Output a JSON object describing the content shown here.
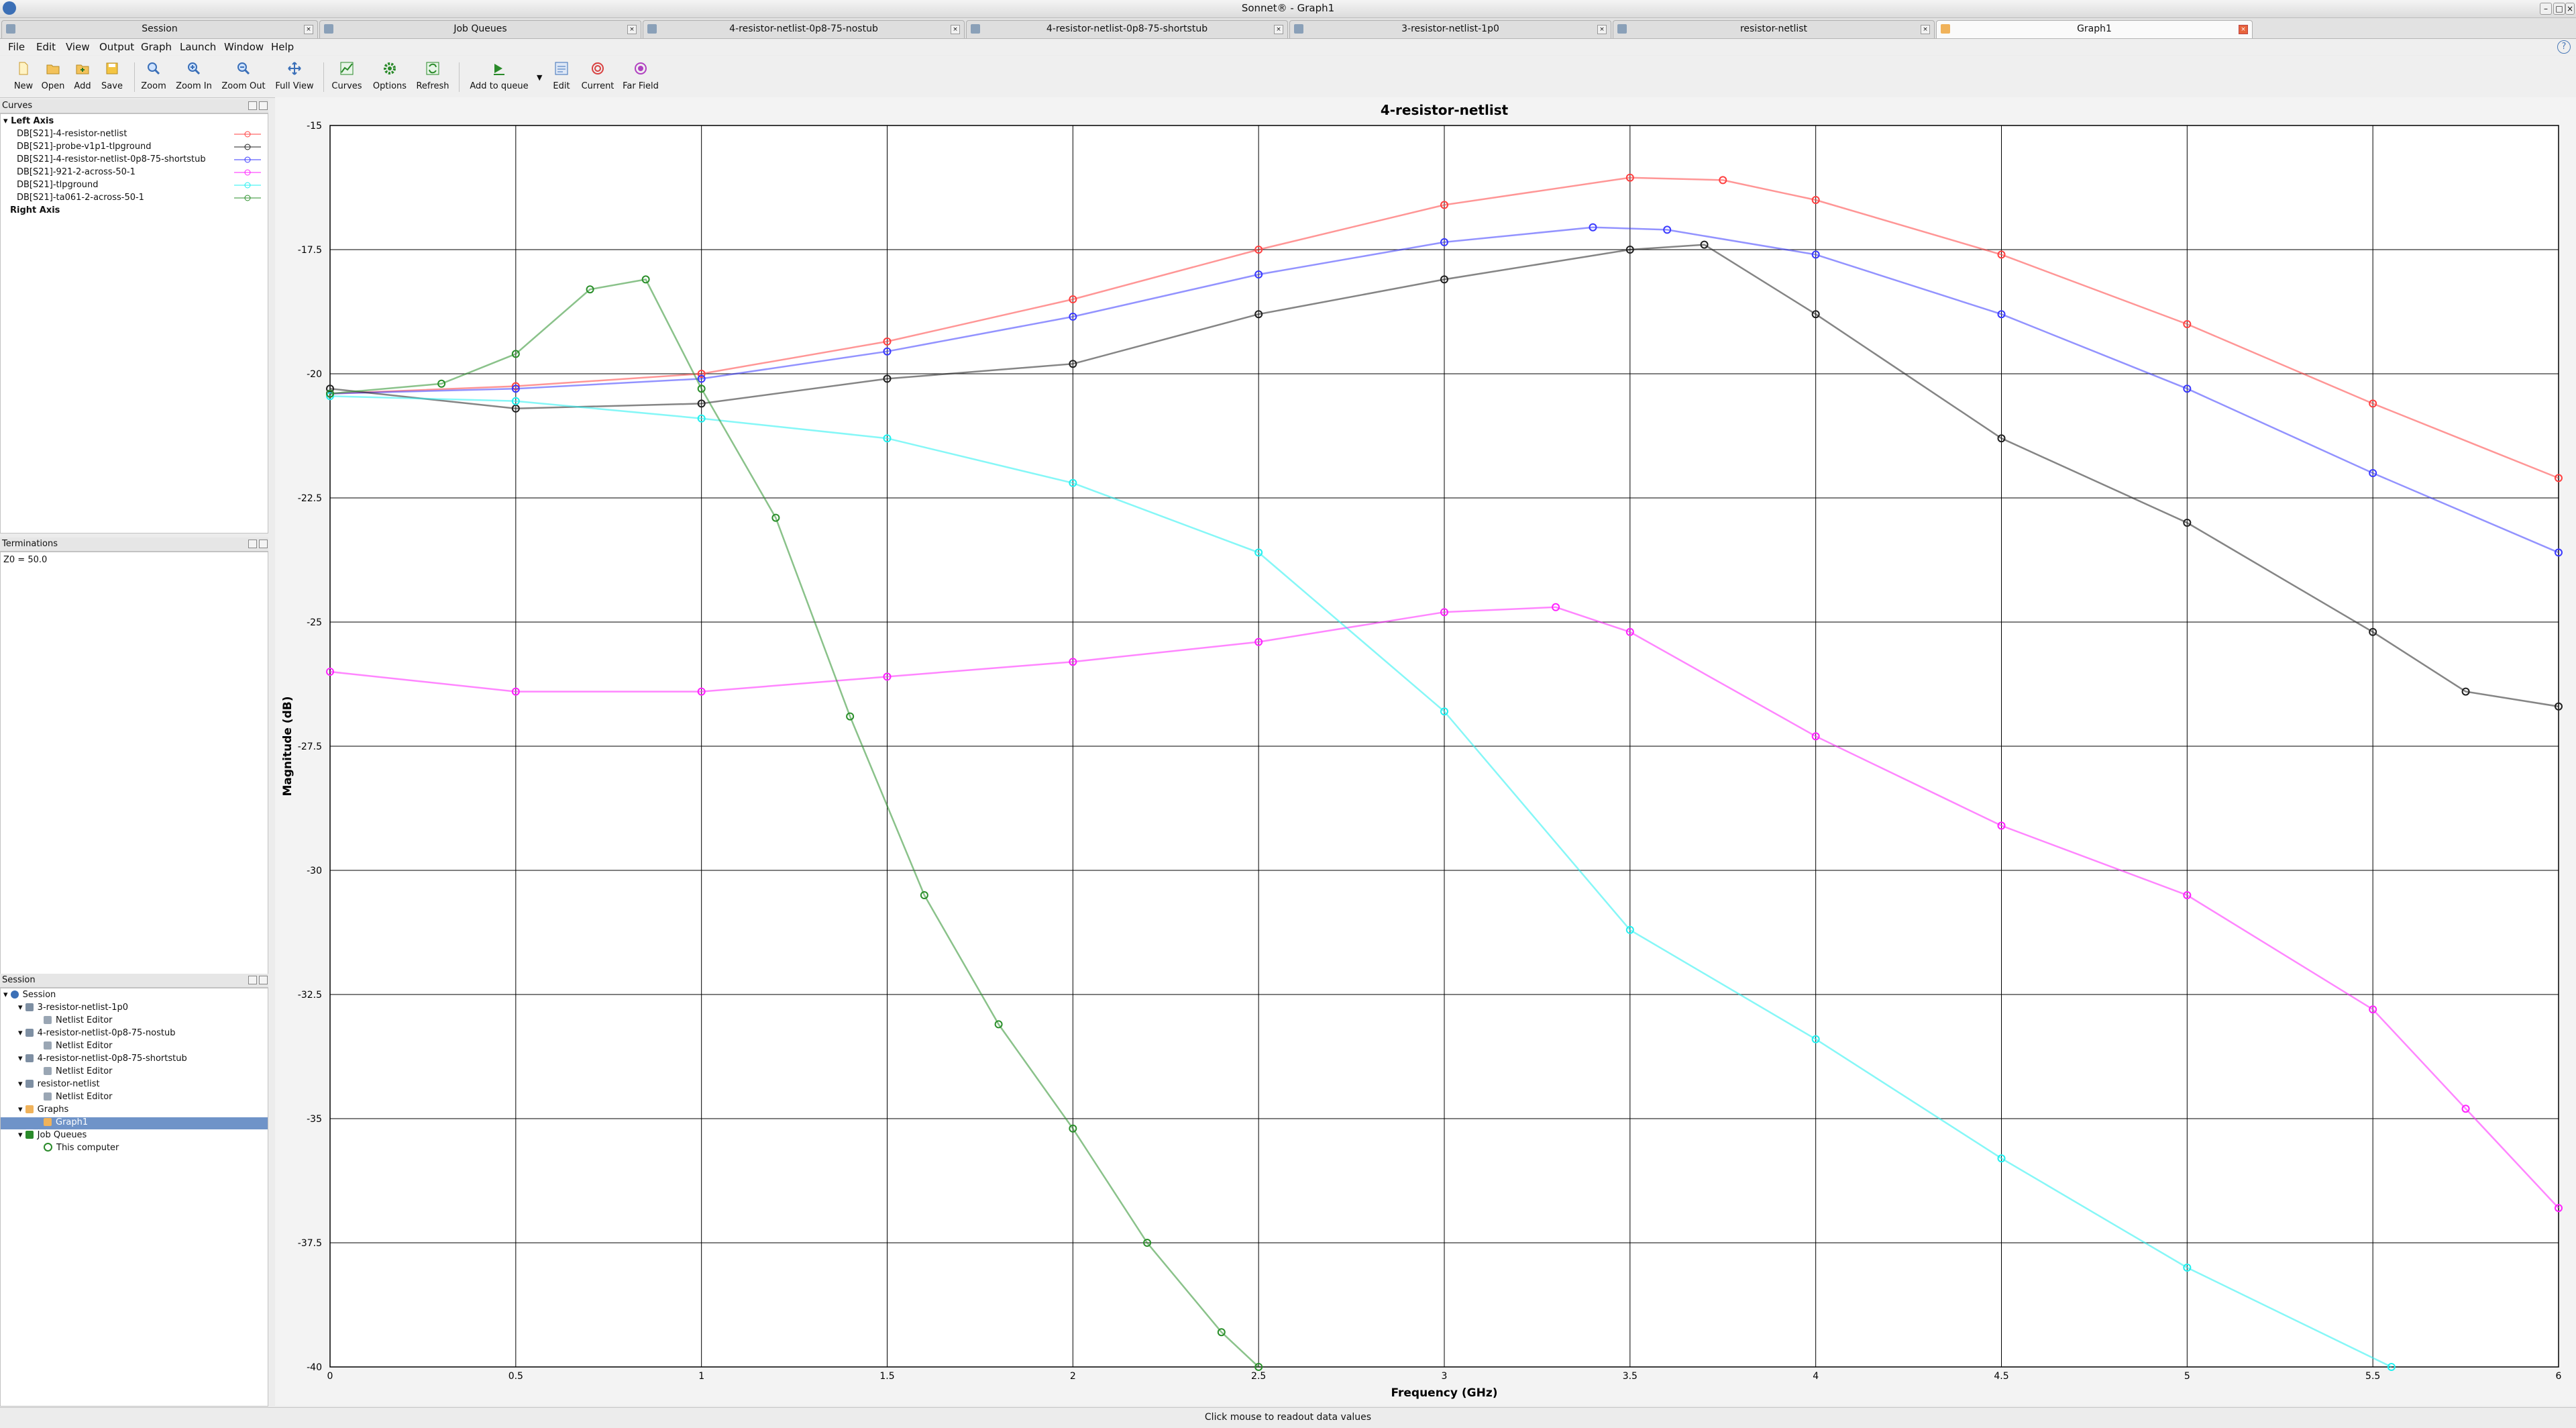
{
  "window": {
    "title": "Sonnet® - Graph1"
  },
  "tabs": [
    {
      "label": "Session",
      "active": false
    },
    {
      "label": "Job Queues",
      "active": false
    },
    {
      "label": "4-resistor-netlist-0p8-75-nostub",
      "active": false
    },
    {
      "label": "4-resistor-netlist-0p8-75-shortstub",
      "active": false
    },
    {
      "label": "3-resistor-netlist-1p0",
      "active": false
    },
    {
      "label": "resistor-netlist",
      "active": false
    },
    {
      "label": "Graph1",
      "active": true
    }
  ],
  "menu": [
    "File",
    "Edit",
    "View",
    "Output",
    "Graph",
    "Launch",
    "Window",
    "Help"
  ],
  "toolbar": [
    {
      "label": "New",
      "icon": "new-file-icon"
    },
    {
      "label": "Open",
      "icon": "open-folder-icon"
    },
    {
      "label": "Add",
      "icon": "add-folder-icon"
    },
    {
      "label": "Save",
      "icon": "save-icon"
    },
    {
      "label": "Zoom",
      "icon": "zoom-icon"
    },
    {
      "label": "Zoom In",
      "icon": "zoom-in-icon"
    },
    {
      "label": "Zoom Out",
      "icon": "zoom-out-icon"
    },
    {
      "label": "Full View",
      "icon": "full-view-icon"
    },
    {
      "label": "Curves",
      "icon": "curves-icon"
    },
    {
      "label": "Options",
      "icon": "options-gear-icon"
    },
    {
      "label": "Refresh",
      "icon": "refresh-icon"
    },
    {
      "label": "Add to queue",
      "icon": "add-to-queue-icon"
    },
    {
      "label": "Edit",
      "icon": "edit-icon"
    },
    {
      "label": "Current",
      "icon": "current-icon"
    },
    {
      "label": "Far Field",
      "icon": "far-field-icon"
    }
  ],
  "curves_panel": {
    "title": "Curves",
    "left_axis": "Left Axis",
    "right_axis": "Right Axis",
    "items": [
      {
        "label": "DB[S21]-4-resistor-netlist",
        "color": "#ff4040"
      },
      {
        "label": "DB[S21]-probe-v1p1-tlpground",
        "color": "#202020"
      },
      {
        "label": "DB[S21]-4-resistor-netlist-0p8-75-shortstub",
        "color": "#3a3aff"
      },
      {
        "label": "DB[S21]-921-2-across-50-1",
        "color": "#ff22ff"
      },
      {
        "label": "DB[S21]-tlpground",
        "color": "#22f0f0"
      },
      {
        "label": "DB[S21]-ta061-2-across-50-1",
        "color": "#2a8f2a"
      }
    ]
  },
  "terminations_panel": {
    "title": "Terminations",
    "text": "Z0 = 50.0"
  },
  "session_panel": {
    "title": "Session",
    "tree": [
      {
        "label": "Session",
        "level": 0,
        "icon": "session-icon"
      },
      {
        "label": "3-resistor-netlist-1p0",
        "level": 1,
        "icon": "netlist-icon"
      },
      {
        "label": "Netlist Editor",
        "level": 2,
        "icon": "netlist-editor-icon"
      },
      {
        "label": "4-resistor-netlist-0p8-75-nostub",
        "level": 1,
        "icon": "netlist-icon"
      },
      {
        "label": "Netlist Editor",
        "level": 2,
        "icon": "netlist-editor-icon"
      },
      {
        "label": "4-resistor-netlist-0p8-75-shortstub",
        "level": 1,
        "icon": "netlist-icon"
      },
      {
        "label": "Netlist Editor",
        "level": 2,
        "icon": "netlist-editor-icon"
      },
      {
        "label": "resistor-netlist",
        "level": 1,
        "icon": "netlist-icon"
      },
      {
        "label": "Netlist Editor",
        "level": 2,
        "icon": "netlist-editor-icon"
      },
      {
        "label": "Graphs",
        "level": 1,
        "icon": "graphs-folder-icon"
      },
      {
        "label": "Graph1",
        "level": 2,
        "icon": "graph-icon",
        "selected": true
      },
      {
        "label": "Job Queues",
        "level": 1,
        "icon": "job-queues-icon"
      },
      {
        "label": "This computer",
        "level": 2,
        "icon": "computer-icon"
      }
    ]
  },
  "status_bar": {
    "text": "Click mouse to readout data values"
  },
  "chart_data": {
    "type": "scatter",
    "title": "4-resistor-netlist",
    "xlabel": "Frequency (GHz)",
    "ylabel": "Magnitude (dB)",
    "xlim": [
      0,
      6
    ],
    "ylim": [
      -40,
      -15
    ],
    "xticks": [
      "0",
      "0.5",
      "1",
      "1.5",
      "2",
      "2.5",
      "3",
      "3.5",
      "4",
      "4.5",
      "5",
      "5.5",
      "6"
    ],
    "yticks": [
      "-15",
      "-17.5",
      "-20",
      "-22.5",
      "-25",
      "-27.5",
      "-30",
      "-32.5",
      "-35",
      "-37.5",
      "-40"
    ],
    "grid": true,
    "series": [
      {
        "name": "DB[S21]-4-resistor-netlist",
        "color": "#ff4040",
        "points": [
          [
            0,
            -20.4
          ],
          [
            0.5,
            -20.25
          ],
          [
            1,
            -20.0
          ],
          [
            1.5,
            -19.35
          ],
          [
            2,
            -18.5
          ],
          [
            2.5,
            -17.5
          ],
          [
            3,
            -16.6
          ],
          [
            3.5,
            -16.05
          ],
          [
            3.75,
            -16.1
          ],
          [
            4,
            -16.5
          ],
          [
            4.5,
            -17.6
          ],
          [
            5,
            -19.0
          ],
          [
            5.5,
            -20.6
          ],
          [
            6,
            -22.1
          ]
        ]
      },
      {
        "name": "DB[S21]-4-resistor-netlist-0p8-75-shortstub",
        "color": "#3a3aff",
        "points": [
          [
            0,
            -20.4
          ],
          [
            0.5,
            -20.3
          ],
          [
            1,
            -20.1
          ],
          [
            1.5,
            -19.55
          ],
          [
            2,
            -18.85
          ],
          [
            2.5,
            -18.0
          ],
          [
            3,
            -17.35
          ],
          [
            3.4,
            -17.05
          ],
          [
            3.6,
            -17.1
          ],
          [
            4,
            -17.6
          ],
          [
            4.5,
            -18.8
          ],
          [
            5,
            -20.3
          ],
          [
            5.5,
            -22.0
          ],
          [
            6,
            -23.6
          ]
        ]
      },
      {
        "name": "DB[S21]-probe-v1p1-tlpground",
        "color": "#202020",
        "points": [
          [
            0,
            -20.3
          ],
          [
            0.5,
            -20.7
          ],
          [
            1,
            -20.6
          ],
          [
            1.5,
            -20.1
          ],
          [
            2,
            -19.8
          ],
          [
            2.5,
            -18.8
          ],
          [
            3,
            -18.1
          ],
          [
            3.5,
            -17.5
          ],
          [
            3.7,
            -17.4
          ],
          [
            4,
            -18.8
          ],
          [
            4.5,
            -21.3
          ],
          [
            5,
            -23.0
          ],
          [
            5.5,
            -25.2
          ],
          [
            5.75,
            -26.4
          ],
          [
            6,
            -26.7
          ]
        ]
      },
      {
        "name": "DB[S21]-921-2-across-50-1",
        "color": "#ff22ff",
        "points": [
          [
            0,
            -26.0
          ],
          [
            0.5,
            -26.4
          ],
          [
            1,
            -26.4
          ],
          [
            1.5,
            -26.1
          ],
          [
            2,
            -25.8
          ],
          [
            2.5,
            -25.4
          ],
          [
            3,
            -24.8
          ],
          [
            3.3,
            -24.7
          ],
          [
            3.5,
            -25.2
          ],
          [
            4,
            -27.3
          ],
          [
            4.5,
            -29.1
          ],
          [
            5,
            -30.5
          ],
          [
            5.5,
            -32.8
          ],
          [
            5.75,
            -34.8
          ],
          [
            6,
            -36.8
          ]
        ]
      },
      {
        "name": "DB[S21]-tlpground",
        "color": "#22f0f0",
        "points": [
          [
            0,
            -20.45
          ],
          [
            0.5,
            -20.55
          ],
          [
            1,
            -20.9
          ],
          [
            1.5,
            -21.3
          ],
          [
            2,
            -22.2
          ],
          [
            2.5,
            -23.6
          ],
          [
            3,
            -26.8
          ],
          [
            3.5,
            -31.2
          ],
          [
            4,
            -33.4
          ],
          [
            4.5,
            -35.8
          ],
          [
            5,
            -38.0
          ],
          [
            5.55,
            -40.0
          ]
        ]
      },
      {
        "name": "DB[S21]-ta061-2-across-50-1",
        "color": "#2a8f2a",
        "points": [
          [
            0,
            -20.4
          ],
          [
            0.3,
            -20.2
          ],
          [
            0.5,
            -19.6
          ],
          [
            0.7,
            -18.3
          ],
          [
            0.85,
            -18.1
          ],
          [
            1,
            -20.3
          ],
          [
            1.2,
            -22.9
          ],
          [
            1.4,
            -26.9
          ],
          [
            1.6,
            -30.5
          ],
          [
            1.8,
            -33.1
          ],
          [
            2,
            -35.2
          ],
          [
            2.2,
            -37.5
          ],
          [
            2.4,
            -39.3
          ],
          [
            2.5,
            -40.0
          ]
        ]
      }
    ]
  }
}
